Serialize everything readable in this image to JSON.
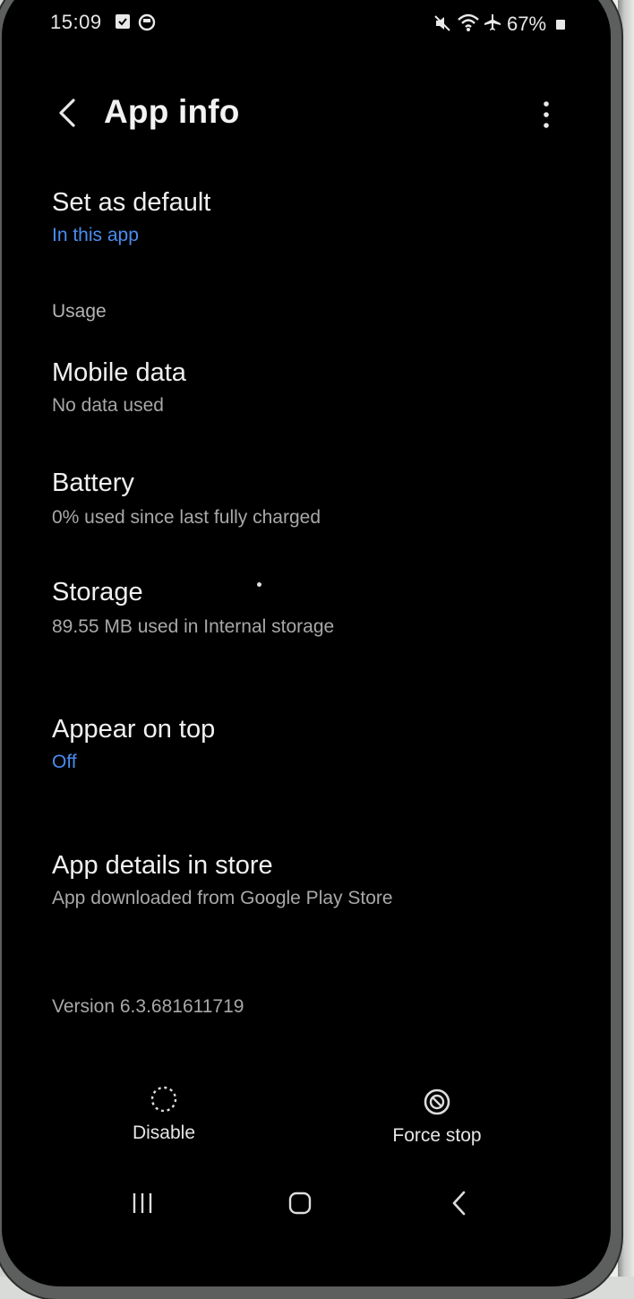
{
  "status_bar": {
    "time": "15:09",
    "battery_percent": "67%",
    "icons": [
      "calendar-check-icon",
      "media-icon",
      "mute-icon",
      "wifi-icon",
      "airplane-icon",
      "battery-icon"
    ]
  },
  "header": {
    "title": "App info",
    "back_icon": "chevron-left-icon",
    "more_icon": "more-vertical-icon"
  },
  "items": {
    "set_default": {
      "title": "Set as default",
      "subtitle": "In this app"
    },
    "usage_label": "Usage",
    "mobile_data": {
      "title": "Mobile data",
      "subtitle": "No data used"
    },
    "battery": {
      "title": "Battery",
      "subtitle": "0% used since last fully charged"
    },
    "storage": {
      "title": "Storage",
      "subtitle": "89.55 MB used in Internal storage"
    },
    "appear_on_top": {
      "title": "Appear on top",
      "subtitle": "Off"
    },
    "app_details": {
      "title": "App details in store",
      "subtitle": "App downloaded from Google Play Store"
    }
  },
  "version": "Version 6.3.681611719",
  "bottom_actions": {
    "disable": {
      "label": "Disable",
      "icon": "disable-icon"
    },
    "force_stop": {
      "label": "Force stop",
      "icon": "force-stop-icon"
    }
  },
  "nav_bar": {
    "icons": [
      "recents-icon",
      "home-icon",
      "back-icon"
    ]
  },
  "colors": {
    "background": "#000000",
    "accent": "#4a8cf0",
    "primary_text": "#f0f0f0",
    "secondary_text": "#a8a8a8"
  }
}
